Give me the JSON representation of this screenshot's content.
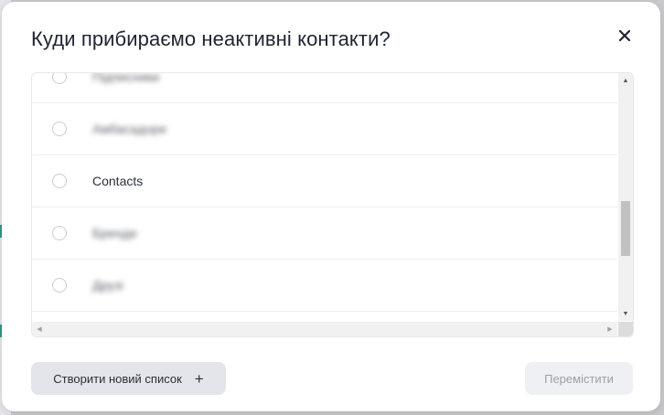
{
  "dialog": {
    "title": "Куди прибираємо неактивні контакти?",
    "close_icon": "close-icon"
  },
  "lists": {
    "items": [
      {
        "label": "Підписники",
        "blurred": true,
        "selected": false
      },
      {
        "label": "Амбасадори",
        "blurred": true,
        "selected": false
      },
      {
        "label": "Contacts",
        "blurred": false,
        "selected": false
      },
      {
        "label": "Бренди",
        "blurred": true,
        "selected": false
      },
      {
        "label": "Друзі",
        "blurred": true,
        "selected": false
      }
    ]
  },
  "footer": {
    "create_label": "Створити новий список",
    "create_icon": "plus-icon",
    "move_label": "Перемістити",
    "move_disabled": true
  },
  "colors": {
    "title": "#1f2430",
    "secondary_button_bg": "#e3e5ea",
    "disabled_button_bg": "#eef0f3",
    "disabled_button_text": "#9ba0aa",
    "backdrop_accent": "#2f9a8a"
  }
}
